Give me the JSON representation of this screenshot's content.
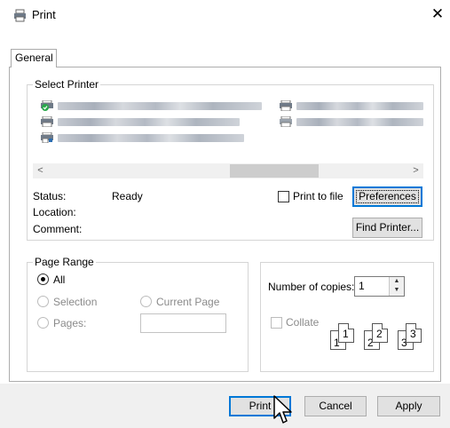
{
  "window": {
    "title": "Print",
    "close_glyph": "✕"
  },
  "tabs": [
    {
      "label": "General"
    }
  ],
  "select_printer": {
    "legend": "Select Printer",
    "scroll_left": "<",
    "scroll_right": ">"
  },
  "status": {
    "status_label": "Status:",
    "status_value": "Ready",
    "location_label": "Location:",
    "comment_label": "Comment:",
    "print_to_file_label": "Print to file",
    "print_to_file_checked": false
  },
  "buttons": {
    "preferences": "Preferences",
    "find_printer": "Find Printer...",
    "print": "Print",
    "cancel": "Cancel",
    "apply": "Apply"
  },
  "page_range": {
    "legend": "Page Range",
    "all": "All",
    "selection": "Selection",
    "current_page": "Current Page",
    "pages": "Pages:",
    "pages_value": ""
  },
  "copies": {
    "label": "Number of copies:",
    "value": "1",
    "collate_label": "Collate",
    "collate_checked": false,
    "collate_pages": [
      "1",
      "1",
      "2",
      "2",
      "3",
      "3"
    ]
  },
  "icons": {
    "app": "printer-icon",
    "close": "close-icon"
  },
  "colors": {
    "accent": "#0078d7",
    "button_face": "#e1e1e1"
  }
}
